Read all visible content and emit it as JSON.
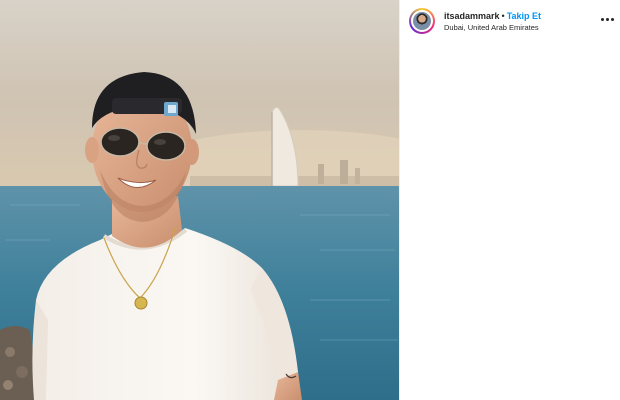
{
  "post": {
    "username": "itsadammark",
    "separator": "•",
    "follow_label": "Takip Et",
    "location": "Dubai, United Arab Emirates",
    "more_icon": "more-horizontal-icon"
  },
  "colors": {
    "follow": "#0095f6",
    "text": "#262626",
    "sky": "#c9c6c0",
    "sea": "#3f7f98"
  }
}
